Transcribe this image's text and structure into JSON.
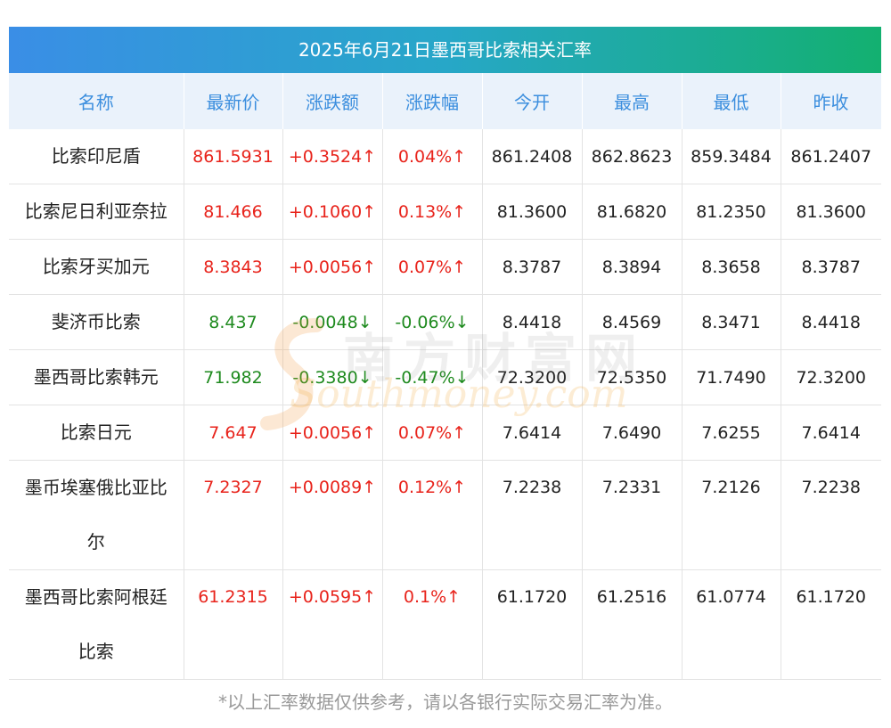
{
  "title": "2025年6月21日墨西哥比索相关汇率",
  "headers": [
    "名称",
    "最新价",
    "涨跌额",
    "涨跌幅",
    "今开",
    "最高",
    "最低",
    "昨收"
  ],
  "rows": [
    {
      "name": "比索印尼盾",
      "latest": "861.5931",
      "change": "+0.3524↑",
      "pct": "0.04%↑",
      "open": "861.2408",
      "high": "862.8623",
      "low": "859.3484",
      "prev": "861.2407",
      "trend": "up"
    },
    {
      "name": "比索尼日利亚奈拉",
      "latest": "81.466",
      "change": "+0.1060↑",
      "pct": "0.13%↑",
      "open": "81.3600",
      "high": "81.6820",
      "low": "81.2350",
      "prev": "81.3600",
      "trend": "up"
    },
    {
      "name": "比索牙买加元",
      "latest": "8.3843",
      "change": "+0.0056↑",
      "pct": "0.07%↑",
      "open": "8.3787",
      "high": "8.3894",
      "low": "8.3658",
      "prev": "8.3787",
      "trend": "up"
    },
    {
      "name": "斐济币比索",
      "latest": "8.437",
      "change": "-0.0048↓",
      "pct": "-0.06%↓",
      "open": "8.4418",
      "high": "8.4569",
      "low": "8.3471",
      "prev": "8.4418",
      "trend": "down"
    },
    {
      "name": "墨西哥比索韩元",
      "latest": "71.982",
      "change": "-0.3380↓",
      "pct": "-0.47%↓",
      "open": "72.3200",
      "high": "72.5350",
      "low": "71.7490",
      "prev": "72.3200",
      "trend": "down"
    },
    {
      "name": "比索日元",
      "latest": "7.647",
      "change": "+0.0056↑",
      "pct": "0.07%↑",
      "open": "7.6414",
      "high": "7.6490",
      "low": "7.6255",
      "prev": "7.6414",
      "trend": "up"
    },
    {
      "name": "墨币埃塞俄比亚比尔",
      "latest": "7.2327",
      "change": "+0.0089↑",
      "pct": "0.12%↑",
      "open": "7.2238",
      "high": "7.2331",
      "low": "7.2126",
      "prev": "7.2238",
      "trend": "up"
    },
    {
      "name": "墨西哥比索阿根廷比索",
      "latest": "61.2315",
      "change": "+0.0595↑",
      "pct": "0.1%↑",
      "open": "61.1720",
      "high": "61.2516",
      "low": "61.0774",
      "prev": "61.1720",
      "trend": "up"
    }
  ],
  "footnote": "*以上汇率数据仅供参考，请以各银行实际交易汇率为准。",
  "watermark": {
    "cn": "南方财富网",
    "en": "Southmoney.com"
  },
  "colors": {
    "up": "#e8231b",
    "down": "#1e8a1e",
    "header_text": "#3b8ede",
    "title_from": "#3a8ee6",
    "title_to": "#13b070"
  }
}
